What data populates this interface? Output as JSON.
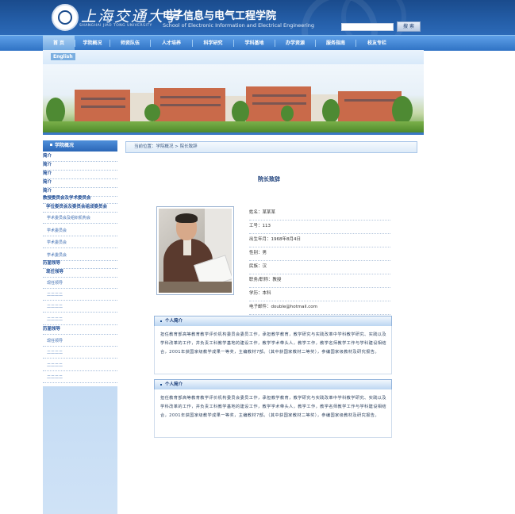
{
  "header": {
    "university_cn": "上海交通大学",
    "university_en": "SHANGHAI JIAO TONG UNIVERSITY",
    "school_cn": "电子信息与电气工程学院",
    "school_en": "School of Electronic Information and Electrical Engineering",
    "search_placeholder": "",
    "search_button": "搜 索"
  },
  "nav": {
    "items": [
      "首  页",
      "学院概况",
      "师资队伍",
      "人才培养",
      "科学研究",
      "学科基地",
      "办学资源",
      "服务指南",
      "校友专栏"
    ]
  },
  "banner": {
    "english_link": "English"
  },
  "sidebar": {
    "title": "学院概况",
    "items": [
      "简介",
      "简介",
      "简介",
      "简介",
      "简介",
      "教授委员会及学术委员会",
      "学位委员会及委员会组成委员会",
      "学术委员会及组织机构会",
      "学术委员会",
      "学术委员会",
      "学术委员会",
      "历届领导",
      "现任领导",
      "现任领导",
      "二二二二",
      "二二二二",
      "二二二二",
      "历届领导",
      "现任领导",
      "二二二二",
      "二二二二",
      "二二二二"
    ]
  },
  "breadcrumb": "当前位置：学院概况 > 院长致辞",
  "page_title": "院长致辞",
  "profile": {
    "name": "姓名：某某某",
    "id": "工号：113",
    "birth": "出生年月：1968年8月4日",
    "gender": "性别：男",
    "ethnicity": "民族：汉",
    "title": "职务/职称：教授",
    "education": "学历：本科",
    "email": "电子邮件：double@hotmail.com"
  },
  "sections": [
    {
      "title": "个人简介",
      "body": "担任教育部高等教育教学评价机构委员会委员工作，承担教学教育，教学研究与实践改革中学科教学研究、实践以及学科改革的工作，并负责工科教学基地的建设工作，教学学术带头人，教学工作，教学名师教学工作与学科建设相结合，2001年获国家级教学成果一等奖，主编教材7部。（其中获国家教材二等奖），参编国家级教材及研究报告。"
    },
    {
      "title": "个人简介",
      "body": "担任教育部高等教育教学评价机构委员会委员工作，承担教学教育，教学研究与实践改革中学科教学研究、实践以及学科改革的工作，并负责工科教学基地的建设工作，教学学术带头人，教学工作，教学名师教学工作与学科建设相结合，2001年获国家级教学成果一等奖，主编教材7部。（其中获国家教材二等奖），参编国家级教材及研究报告。"
    }
  ]
}
